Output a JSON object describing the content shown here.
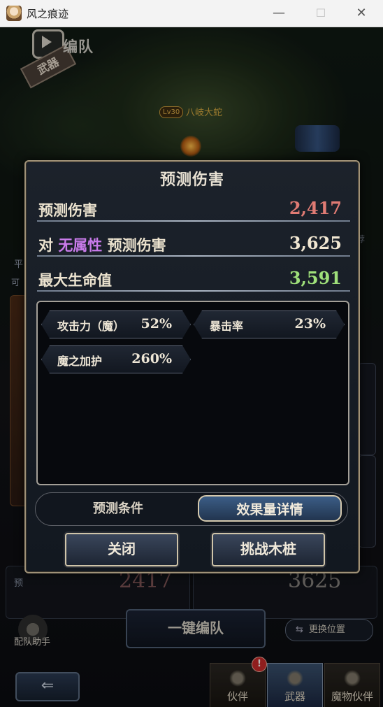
{
  "window": {
    "title": "风之痕迹",
    "min": "—",
    "max": "☐",
    "close": "✕"
  },
  "scene": {
    "team_title": "编队",
    "team_plate": "武器",
    "boss_level": "Lv30",
    "boss_name": "八岐大蛇",
    "bg_ping": "平",
    "bg_ke": "可",
    "bg_yu": "预",
    "bg_jian": "荐",
    "bg_damage_left": "2417",
    "bg_damage_right": "3625",
    "assistant_label": "配队助手",
    "auto_team": "一键编队",
    "swap_position": "更换位置",
    "back_icon": "⇐",
    "nav": [
      {
        "label": "伙伴"
      },
      {
        "label": "武器"
      },
      {
        "label": "魔物伙伴"
      }
    ],
    "nav_badge": "!"
  },
  "dialog": {
    "title": "预测伤害",
    "rows": [
      {
        "label": "预测伤害",
        "value": "2,417"
      },
      {
        "label_prefix": "对",
        "label_attr": "无属性",
        "label_suffix": "预测伤害",
        "value": "3,625"
      },
      {
        "label": "最大生命值",
        "value": "3,591"
      }
    ],
    "effects": [
      {
        "name": "攻击力（魔）",
        "value": "52%"
      },
      {
        "name": "暴击率",
        "value": "23%"
      },
      {
        "name": "魔之加护",
        "value": "260%"
      }
    ],
    "tabs": {
      "conditions": "预测条件",
      "details": "效果量详情"
    },
    "buttons": {
      "close": "关闭",
      "challenge": "挑战木桩"
    }
  },
  "colors": {
    "damage": "#e07b74",
    "attribute": "#c97bea",
    "hp": "#9fe07a",
    "value": "#f1e7d2"
  }
}
